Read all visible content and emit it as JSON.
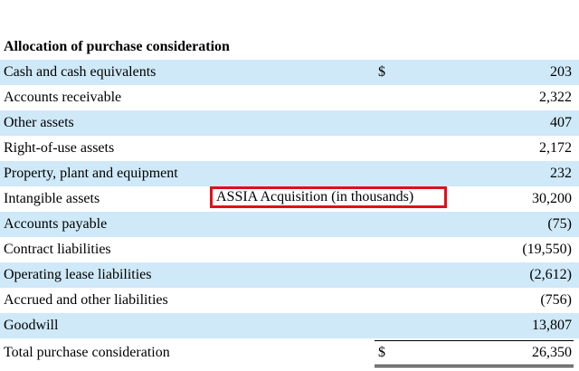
{
  "title": "Allocation of purchase consideration",
  "caption": "ASSIA Acquisition (in thousands)",
  "rows": [
    {
      "label": "Cash and cash equivalents",
      "currency": "$",
      "value": "203"
    },
    {
      "label": "Accounts receivable",
      "currency": "",
      "value": "2,322"
    },
    {
      "label": "Other assets",
      "currency": "",
      "value": "407"
    },
    {
      "label": "Right-of-use assets",
      "currency": "",
      "value": "2,172"
    },
    {
      "label": "Property, plant and equipment",
      "currency": "",
      "value": "232"
    },
    {
      "label": "Intangible assets",
      "currency": "",
      "value": "30,200"
    },
    {
      "label": "Accounts payable",
      "currency": "",
      "value": "(75)"
    },
    {
      "label": "Contract liabilities",
      "currency": "",
      "value": "(19,550)"
    },
    {
      "label": "Operating lease liabilities",
      "currency": "",
      "value": "(2,612)"
    },
    {
      "label": "Accrued and other liabilities",
      "currency": "",
      "value": "(756)"
    },
    {
      "label": "Goodwill",
      "currency": "",
      "value": "13,807"
    }
  ],
  "total": {
    "label": "Total purchase consideration",
    "currency": "$",
    "value": "26,350"
  },
  "colors": {
    "row_shade": "#cfe9f8",
    "highlight_border": "#e0101a"
  }
}
